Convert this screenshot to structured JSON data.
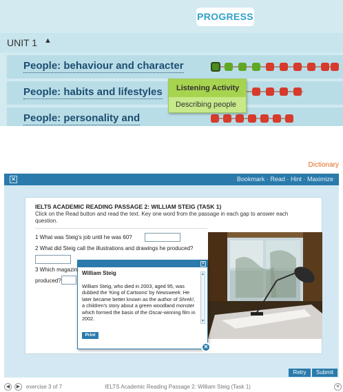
{
  "progress": {
    "button_label": "PROGRESS",
    "unit_label": "UNIT 1",
    "unit_caret": "▲",
    "topics": [
      {
        "label": "People: behaviour and character",
        "dots": [
          "current",
          "green",
          "green",
          "green",
          "red",
          "red",
          "red",
          "red",
          "red",
          "red"
        ]
      },
      {
        "label": "People: habits and lifestyles",
        "dots": [
          "red",
          "red",
          "red",
          "red",
          "red",
          "red",
          "red"
        ]
      },
      {
        "label": "People: personality and",
        "dots": [
          "red",
          "red",
          "red",
          "red",
          "red",
          "red",
          "red"
        ]
      }
    ],
    "tooltip": {
      "active_item": "Listening Activity",
      "next_item": "Describing people"
    }
  },
  "dictionary_link": "Dictionary",
  "window": {
    "close_glyph": "✕",
    "links": [
      "Bookmark",
      "Read",
      "Hint",
      "Maximize"
    ],
    "separator": "·"
  },
  "exercise": {
    "title": "IELTS ACADEMIC READING PASSAGE 2: WILLIAM STEIG (TASK 1)",
    "instructions": "Click on the Read button and read the text. Key one word from the passage in each gap to answer each question.",
    "q1": "1 What was Steig's job until he was 60?",
    "q2": "2 What did Steig call the illustrations and drawings he produced?",
    "q3_start": "3 Which magazin",
    "q3_end": "produced?"
  },
  "popup": {
    "title": "William Steig",
    "text_a": "William Steig, who died in 2003, aged 95, was dubbed the 'King of Cartoons' by ",
    "text_italic_a": "Newsweek",
    "text_b": ". He later became better known as the author of ",
    "text_italic_b": "Shrek!",
    "text_c": ", a children's story about a green woodland monster which formed the basis of the Oscar-winning film in 2002.",
    "print_label": "Print",
    "close_glyph": "✕"
  },
  "actions": {
    "retry": "Retry",
    "submit": "Submit"
  },
  "footer": {
    "exercise_counter": "exercise 3 of 7",
    "exercise_title": "IELTS Academic Reading Passage 2: William Steig (Task 1)",
    "prev_glyph": "◀",
    "next_glyph": "▶",
    "close_glyph": "✕"
  },
  "colors": {
    "accent": "#2a7aab",
    "progress_green": "#5fa825",
    "progress_red": "#d63b2c",
    "dictionary": "#e06a1c"
  }
}
